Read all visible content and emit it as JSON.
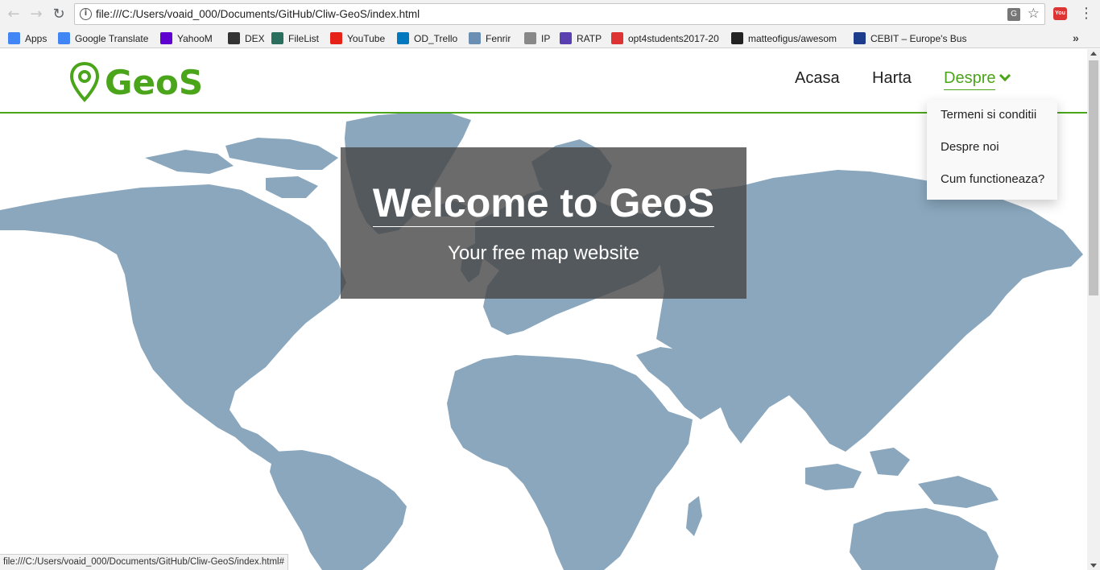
{
  "browser": {
    "url": "file:///C:/Users/voaid_000/Documents/GitHub/Cliw-GeoS/index.html",
    "bookmarks": [
      {
        "label": "Apps",
        "color": "#4285f4"
      },
      {
        "label": "Google Translate",
        "color": "#4285f4"
      },
      {
        "label": "YahooM",
        "color": "#5f01d1"
      },
      {
        "label": "DEX",
        "color": "#333333"
      },
      {
        "label": "FileList",
        "color": "#2a6f5e"
      },
      {
        "label": "YouTube",
        "color": "#e62117"
      },
      {
        "label": "OD_Trello",
        "color": "#0079bf"
      },
      {
        "label": "Fenrir",
        "color": "#6b8fb3"
      },
      {
        "label": "IP",
        "color": "#888888"
      },
      {
        "label": "RATP",
        "color": "#5a3fb0"
      },
      {
        "label": "opt4students2017-20",
        "color": "#d33"
      },
      {
        "label": "matteofigus/awesom",
        "color": "#222222"
      },
      {
        "label": "CEBIT – Europe's Busi",
        "color": "#1e3c8c"
      }
    ],
    "more": "»",
    "status_url": "file:///C:/Users/voaid_000/Documents/GitHub/Cliw-GeoS/index.html#"
  },
  "site": {
    "logo_text": "GeoS",
    "nav": {
      "home": "Acasa",
      "map": "Harta",
      "about": "Despre"
    },
    "dropdown": [
      "Termeni si conditii",
      "Despre noi",
      "Cum functioneaza?"
    ],
    "hero": {
      "title": "Welcome to GeoS",
      "subtitle": "Your free map website"
    },
    "colors": {
      "accent": "#4aa51b",
      "map_land": "#8aa7bd"
    }
  }
}
